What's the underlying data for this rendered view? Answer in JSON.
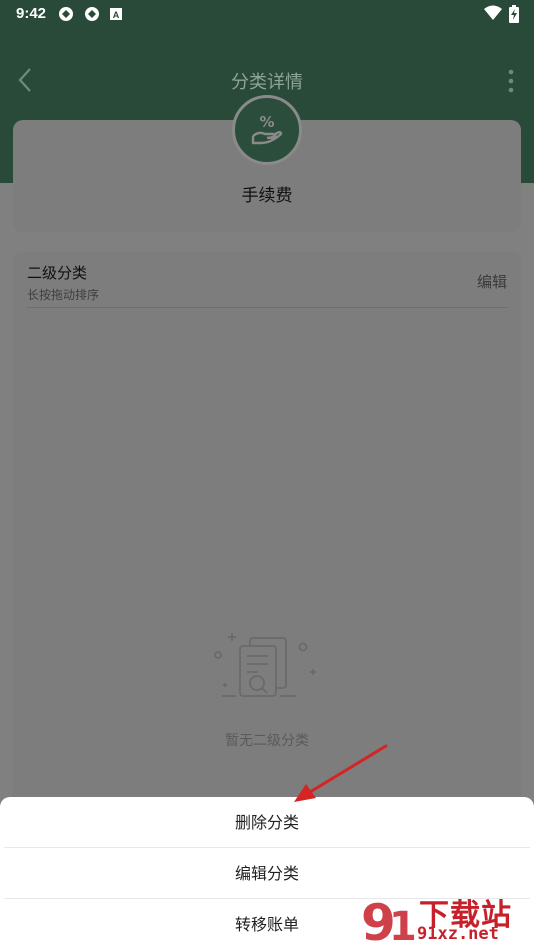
{
  "status_bar": {
    "time": "9:42",
    "notification_icons": [
      "sync-icon",
      "sync-icon",
      "font-a-icon"
    ],
    "right_icons": [
      "wifi-icon",
      "battery-charging-icon"
    ]
  },
  "app_bar": {
    "title": "分类详情",
    "back_icon": "chevron-left-icon",
    "menu_icon": "more-vertical-icon"
  },
  "category": {
    "icon": "percent-hand-icon",
    "name": "手续费"
  },
  "subcategory_section": {
    "title": "二级分类",
    "hint": "长按拖动排序",
    "edit_label": "编辑",
    "empty_text": "暂无二级分类",
    "empty_icon": "empty-document-icon"
  },
  "action_sheet": {
    "items": [
      {
        "label": "删除分类"
      },
      {
        "label": "编辑分类"
      },
      {
        "label": "转移账单"
      }
    ]
  },
  "watermark": {
    "brand": "下载站",
    "url": "91xz.net"
  },
  "colors": {
    "primary": "#2a4a39",
    "overlay": "#808080",
    "sheet_bg": "#ffffff",
    "annotation_arrow": "#d42424",
    "watermark": "#c6202b"
  }
}
